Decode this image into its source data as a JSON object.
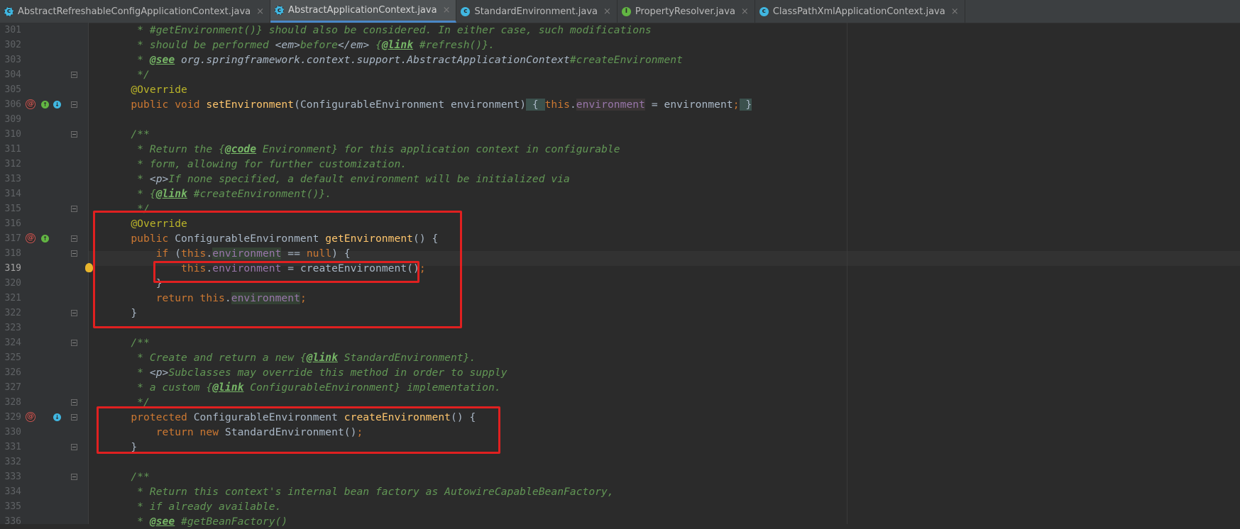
{
  "tabs": [
    {
      "label": "AbstractRefreshableConfigApplicationContext.java",
      "kind": "abstract-class",
      "active": false,
      "closable": true
    },
    {
      "label": "AbstractApplicationContext.java",
      "kind": "abstract-class",
      "active": true,
      "closable": true
    },
    {
      "label": "StandardEnvironment.java",
      "kind": "class",
      "active": false,
      "closable": true
    },
    {
      "label": "PropertyResolver.java",
      "kind": "interface",
      "active": false,
      "closable": true
    },
    {
      "label": "ClassPathXmlApplicationContext.java",
      "kind": "class",
      "active": false,
      "closable": true
    }
  ],
  "close_glyph": "×",
  "icon_letters": {
    "class": "c",
    "abstract-class": "c",
    "interface": "I",
    "override": "↑",
    "implement": "↓",
    "at": "@"
  },
  "editor": {
    "current_line": "319",
    "lines": [
      {
        "n": "301",
        "text": "     * #getEnvironment()} should also be considered. In either case, such modifications"
      },
      {
        "n": "302",
        "text": "     * should be performed <em>before</em> {@link #refresh()}."
      },
      {
        "n": "303",
        "text": "     * @see org.springframework.context.support.AbstractApplicationContext#createEnvironment"
      },
      {
        "n": "304",
        "text": "     */"
      },
      {
        "n": "305",
        "text": "    @Override"
      },
      {
        "n": "306",
        "text": "    public void setEnvironment(ConfigurableEnvironment environment) { this.environment = environment; }"
      },
      {
        "n": "309",
        "text": ""
      },
      {
        "n": "310",
        "text": "    /**"
      },
      {
        "n": "311",
        "text": "     * Return the {@code Environment} for this application context in configurable"
      },
      {
        "n": "312",
        "text": "     * form, allowing for further customization."
      },
      {
        "n": "313",
        "text": "     * <p>If none specified, a default environment will be initialized via"
      },
      {
        "n": "314",
        "text": "     * {@link #createEnvironment()}."
      },
      {
        "n": "315",
        "text": "     */"
      },
      {
        "n": "316",
        "text": "    @Override"
      },
      {
        "n": "317",
        "text": "    public ConfigurableEnvironment getEnvironment() {"
      },
      {
        "n": "318",
        "text": "        if (this.environment == null) {"
      },
      {
        "n": "319",
        "text": "            this.environment = createEnvironment();"
      },
      {
        "n": "320",
        "text": "        }"
      },
      {
        "n": "321",
        "text": "        return this.environment;"
      },
      {
        "n": "322",
        "text": "    }"
      },
      {
        "n": "323",
        "text": ""
      },
      {
        "n": "324",
        "text": "    /**"
      },
      {
        "n": "325",
        "text": "     * Create and return a new {@link StandardEnvironment}."
      },
      {
        "n": "326",
        "text": "     * <p>Subclasses may override this method in order to supply"
      },
      {
        "n": "327",
        "text": "     * a custom {@link ConfigurableEnvironment} implementation."
      },
      {
        "n": "328",
        "text": "     */"
      },
      {
        "n": "329",
        "text": "    protected ConfigurableEnvironment createEnvironment() {"
      },
      {
        "n": "330",
        "text": "        return new StandardEnvironment();"
      },
      {
        "n": "331",
        "text": "    }"
      },
      {
        "n": "332",
        "text": ""
      },
      {
        "n": "333",
        "text": "    /**"
      },
      {
        "n": "334",
        "text": "     * Return this context's internal bean factory as AutowireCapableBeanFactory,"
      },
      {
        "n": "335",
        "text": "     * if already available."
      },
      {
        "n": "336",
        "text": "     * @see #getBeanFactory()"
      }
    ]
  },
  "colors": {
    "editor_bg": "#2b2b2b",
    "comment": "#629755",
    "keyword": "#cc7832",
    "annotation": "#bbb529",
    "method": "#ffc66d",
    "field": "#9876aa",
    "plain": "#a9b7c6",
    "highlight_box": "#e02020"
  }
}
